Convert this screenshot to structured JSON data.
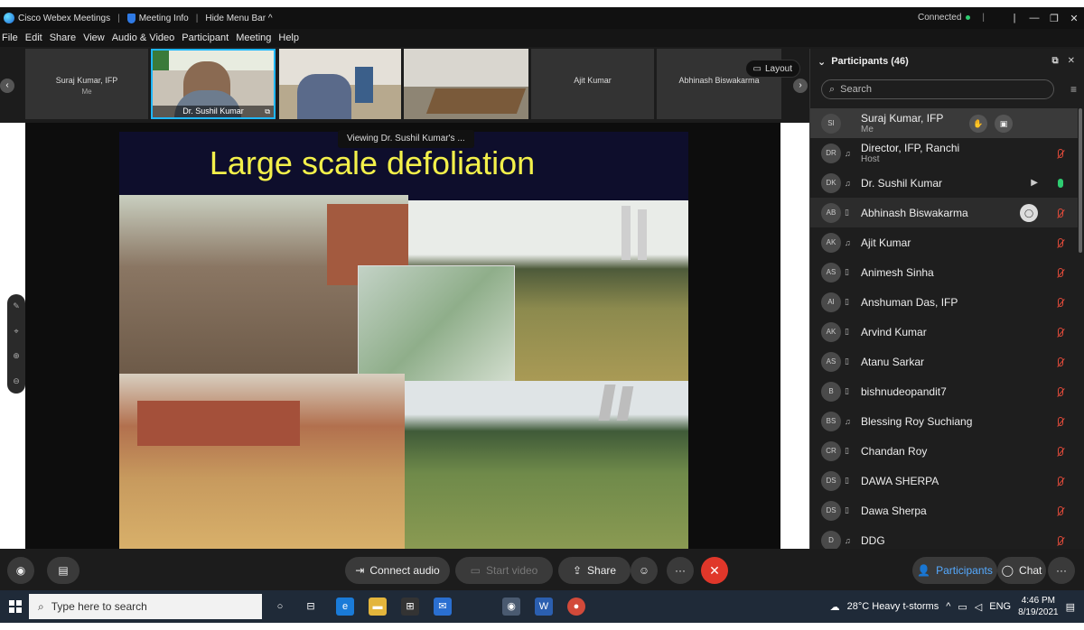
{
  "titlebar": {
    "app_name": "Cisco Webex Meetings",
    "meeting_info": "Meeting Info",
    "hide_menu": "Hide Menu Bar ^",
    "connected": "Connected"
  },
  "menu": [
    "File",
    "Edit",
    "Share",
    "View",
    "Audio & Video",
    "Participant",
    "Meeting",
    "Help"
  ],
  "strip": {
    "thumbs": [
      {
        "name": "Suraj Kumar, IFP",
        "sub": "Me"
      },
      {
        "name": "Dr. Sushil Kumar"
      },
      {
        "name": "Ajit Kumar"
      },
      {
        "name": "Abhinash Biswakarma"
      }
    ],
    "layout_label": "Layout"
  },
  "share": {
    "viewing": "Viewing Dr. Sushil Kumar's ...",
    "slide_title": "Large scale defoliation"
  },
  "panel": {
    "title": "Participants (46)",
    "search_placeholder": "Search",
    "participants": [
      {
        "initials": "SI",
        "name": "Suraj Kumar, IFP",
        "role": "Me"
      },
      {
        "initials": "DR",
        "name": "Director, IFP, Ranchi",
        "role": "Host"
      },
      {
        "initials": "DK",
        "name": "Dr. Sushil Kumar",
        "role": ""
      },
      {
        "initials": "AB",
        "name": "Abhinash Biswakarma",
        "role": ""
      },
      {
        "initials": "AK",
        "name": "Ajit Kumar",
        "role": ""
      },
      {
        "initials": "AS",
        "name": "Animesh Sinha",
        "role": ""
      },
      {
        "initials": "AI",
        "name": "Anshuman Das, IFP",
        "role": ""
      },
      {
        "initials": "AK",
        "name": "Arvind Kumar",
        "role": ""
      },
      {
        "initials": "AS",
        "name": "Atanu Sarkar",
        "role": ""
      },
      {
        "initials": "B",
        "name": "bishnudeopandit7",
        "role": ""
      },
      {
        "initials": "BS",
        "name": "Blessing Roy Suchiang",
        "role": ""
      },
      {
        "initials": "CR",
        "name": "Chandan Roy",
        "role": ""
      },
      {
        "initials": "DS",
        "name": "DAWA SHERPA",
        "role": ""
      },
      {
        "initials": "DS",
        "name": "Dawa Sherpa",
        "role": ""
      },
      {
        "initials": "D",
        "name": "DDG",
        "role": ""
      }
    ]
  },
  "controls": {
    "connect_audio": "Connect audio",
    "start_video": "Start video",
    "share": "Share",
    "participants": "Participants",
    "chat": "Chat"
  },
  "taskbar": {
    "search_placeholder": "Type here to search",
    "weather": "28°C  Heavy t-storms",
    "lang": "ENG",
    "time": "4:46 PM",
    "date": "8/19/2021"
  }
}
